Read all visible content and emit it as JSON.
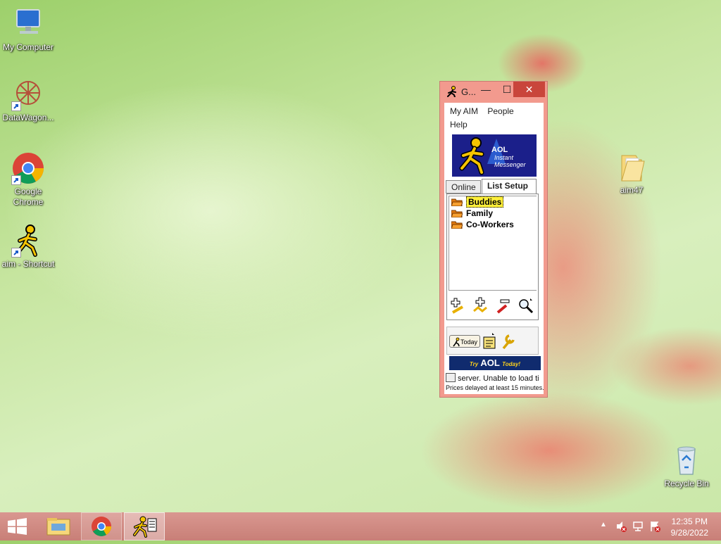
{
  "desktop": {
    "icons": [
      {
        "label": "My Computer",
        "icon": "computer-icon"
      },
      {
        "label": "DataWagon...",
        "icon": "datawagon-icon"
      },
      {
        "label": "Google Chrome",
        "icon": "chrome-icon"
      },
      {
        "label": "aim - Shortcut",
        "icon": "aim-running-man-icon"
      },
      {
        "label": "aim47",
        "icon": "folder-icon"
      },
      {
        "label": "Recycle Bin",
        "icon": "recycle-bin-icon"
      }
    ]
  },
  "aim": {
    "title": "G...",
    "menu": [
      "My AIM",
      "People",
      "Help"
    ],
    "logo_line1": "AOL",
    "logo_line2": "Instant",
    "logo_line3": "Messenger",
    "tabs": [
      "Online",
      "List Setup"
    ],
    "groups": [
      "Buddies",
      "Family",
      "Co-Workers"
    ],
    "today_label": "Today",
    "banner_try": "Try",
    "banner_aol": "AOL",
    "banner_today": "Today!",
    "ticker": "server.  Unable to load ti",
    "delay_note": "Prices delayed at least 15 minutes."
  },
  "taskbar": {
    "time": "12:35 PM",
    "date": "9/28/2022"
  },
  "colors": {
    "window_frame": "#f29a8e",
    "close_button": "#c9453b",
    "logo_bg": "#1b1f8a",
    "selection": "#ffef3a",
    "taskbar": "#d18b84"
  }
}
